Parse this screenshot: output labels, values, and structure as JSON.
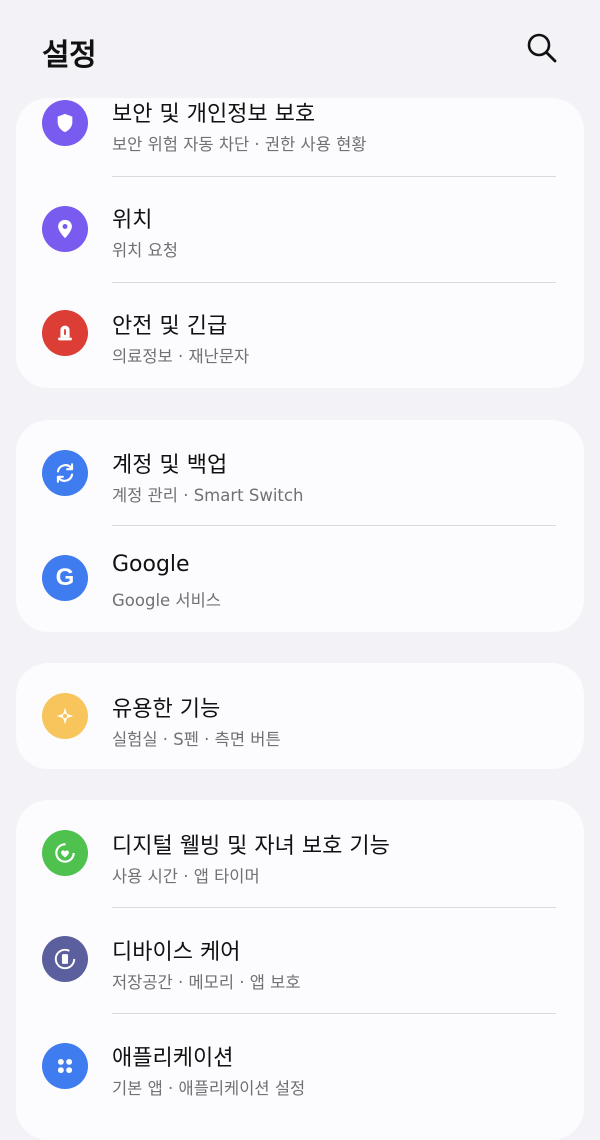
{
  "header": {
    "title": "설정"
  },
  "groups": [
    {
      "items": [
        {
          "label": "보안 및 개인정보 보호",
          "sub": "보안 위험 자동 차단  ·  권한 사용 현황",
          "icon": "shield-icon",
          "color": "#7a5bf0"
        },
        {
          "label": "위치",
          "sub": "위치 요청",
          "icon": "location-pin-icon",
          "color": "#7a5bf0"
        },
        {
          "label": "안전 및 긴급",
          "sub": "의료정보  ·  재난문자",
          "icon": "emergency-light-icon",
          "color": "#dc3d35"
        }
      ]
    },
    {
      "items": [
        {
          "label": "계정 및 백업",
          "sub": "계정 관리  ·  Smart Switch",
          "icon": "sync-icon",
          "color": "#3f7cf0"
        },
        {
          "label": "Google",
          "sub": "Google 서비스",
          "icon": "google-icon",
          "color": "#3f7cf0"
        }
      ]
    },
    {
      "items": [
        {
          "label": "유용한 기능",
          "sub": "실험실  ·  S펜  ·  측면 버튼",
          "icon": "puzzle-star-icon",
          "color": "#f7c55c"
        }
      ]
    },
    {
      "items": [
        {
          "label": "디지털 웰빙 및 자녀 보호 기능",
          "sub": "사용 시간  ·  앱 타이머",
          "icon": "wellbeing-heart-icon",
          "color": "#4fc14f"
        },
        {
          "label": "디바이스 케어",
          "sub": "저장공간  ·  메모리  ·  앱 보호",
          "icon": "device-care-icon",
          "color": "#5b5f9e"
        },
        {
          "label": "애플리케이션",
          "sub": "기본 앱  ·  애플리케이션 설정",
          "icon": "apps-grid-icon",
          "color": "#3f7cf0"
        }
      ]
    }
  ]
}
